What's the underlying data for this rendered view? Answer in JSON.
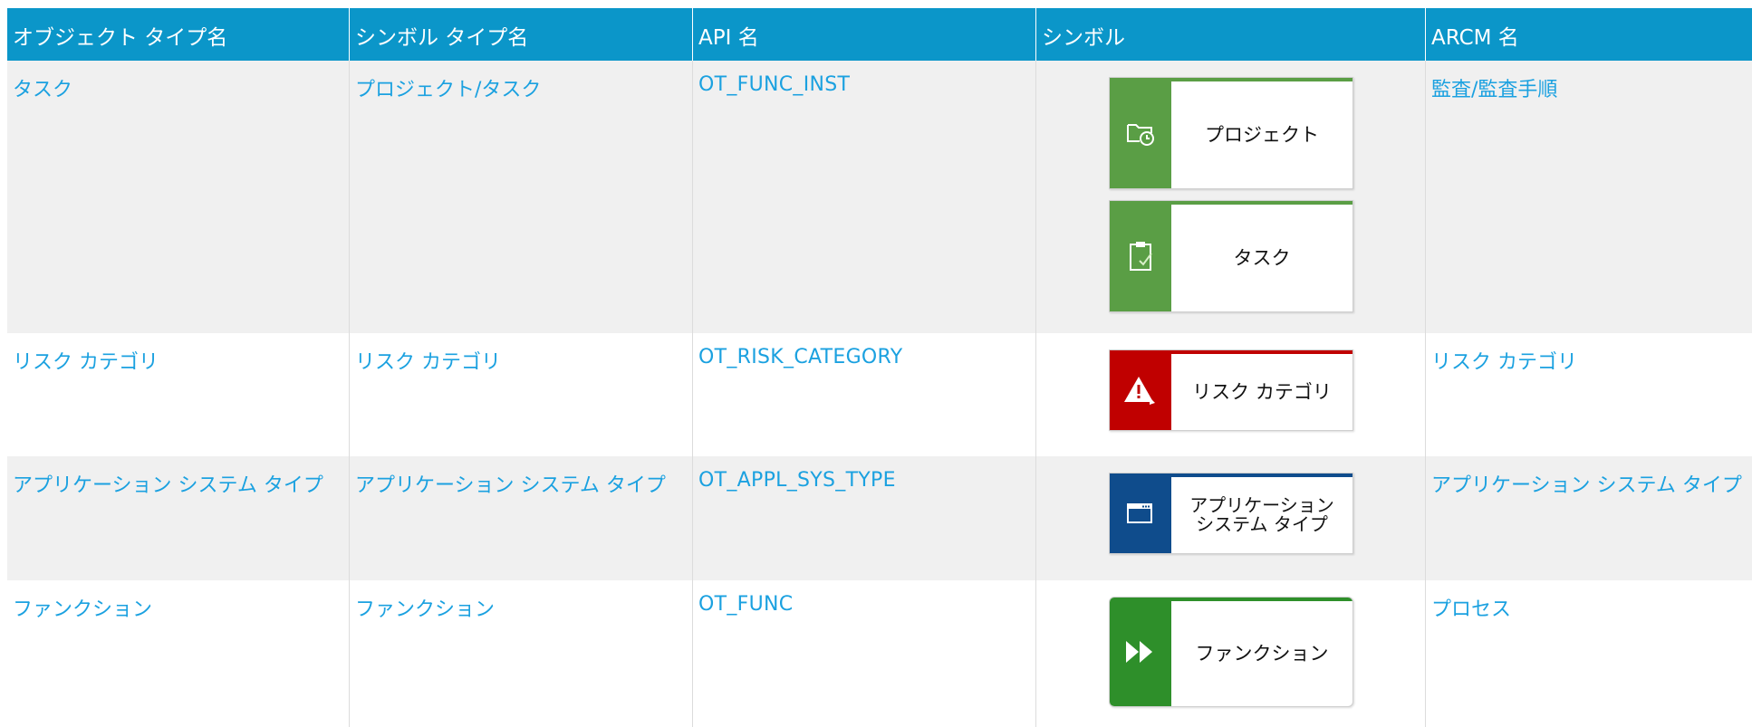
{
  "header": {
    "col1": "オブジェクト タイプ名",
    "col2": "シンボル タイプ名",
    "col3": "API 名",
    "col4": "シンボル",
    "col5": "ARCM 名"
  },
  "rows": [
    {
      "object_type": "タスク",
      "symbol_type": "プロジェクト/タスク",
      "api_name": "OT_FUNC_INST",
      "symbols": [
        {
          "label": "プロジェクト",
          "icon": "folder-clock-icon",
          "color": "#5a9e45"
        },
        {
          "label": "タスク",
          "icon": "clipboard-check-icon",
          "color": "#5a9e45"
        }
      ],
      "arcm_name": "監査/監査手順"
    },
    {
      "object_type": "リスク カテゴリ",
      "symbol_type": "リスク カテゴリ",
      "api_name": "OT_RISK_CATEGORY",
      "symbols": [
        {
          "label": "リスク カテゴリ",
          "icon": "warning-icon",
          "color": "#c00000"
        }
      ],
      "arcm_name": "リスク カテゴリ"
    },
    {
      "object_type": "アプリケーション システム タイプ",
      "symbol_type": "アプリケーション システム タイプ",
      "api_name": "OT_APPL_SYS_TYPE",
      "symbols": [
        {
          "label_line1": "アプリケーション",
          "label_line2": "システム タイプ",
          "icon": "window-icon",
          "color": "#0f4c8c"
        }
      ],
      "arcm_name": "アプリケーション システム タイプ"
    },
    {
      "object_type": "ファンクション",
      "symbol_type": "ファンクション",
      "api_name": "OT_FUNC",
      "symbols": [
        {
          "label": "ファンクション",
          "icon": "fast-forward-icon",
          "color": "#2e8f2a"
        }
      ],
      "arcm_name": "プロセス"
    }
  ]
}
